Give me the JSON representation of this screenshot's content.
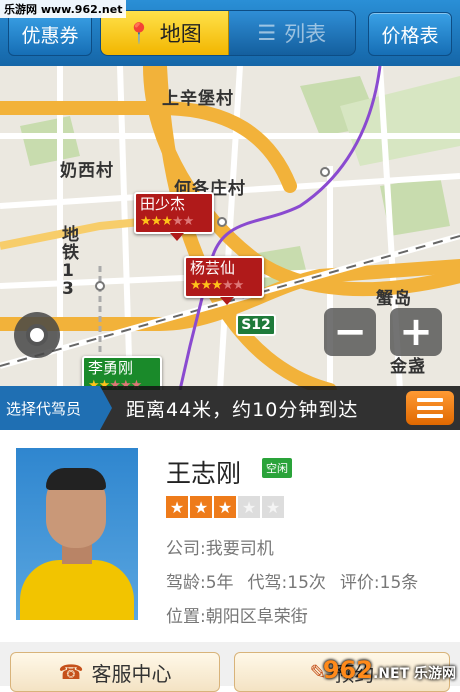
{
  "watermark_top": "乐游网 www.962.net",
  "topbar": {
    "coupon_label": "优惠券",
    "map_tab_label": "地图",
    "list_tab_label": "列表",
    "price_label": "价格表"
  },
  "map": {
    "places": [
      "上辛堡村",
      "奶西村",
      "何各庄村",
      "地铁13",
      "蟹岛",
      "金盏"
    ],
    "road_shield": "S12",
    "markers": [
      {
        "name": "田少杰",
        "stars": 3
      },
      {
        "name": "杨芸仙",
        "stars": 3
      },
      {
        "name": "李勇刚",
        "stars": 2
      }
    ],
    "zoom_out": "−",
    "zoom_in": "+"
  },
  "strip": {
    "select_label": "选择代驾员",
    "distance_text": "距离44米，约10分钟到达"
  },
  "driver": {
    "name": "王志刚",
    "status": "空闲",
    "rating": 3,
    "rating_max": 5,
    "company": "公司:我要司机",
    "experience": "驾龄:5年",
    "drives": "代驾:15次",
    "reviews": "评价:15条",
    "location": "位置:朝阳区阜荣街"
  },
  "bottom": {
    "service_label": "客服中心",
    "book_label": "预约"
  },
  "watermark_bottom": {
    "big": "962",
    "net": ".NET",
    "site": "乐游网"
  },
  "colors": {
    "accent_blue": "#1f6fb3",
    "accent_yellow": "#f2b600",
    "marker_red": "#b01a1a",
    "star_orange": "#ee7b1a"
  }
}
